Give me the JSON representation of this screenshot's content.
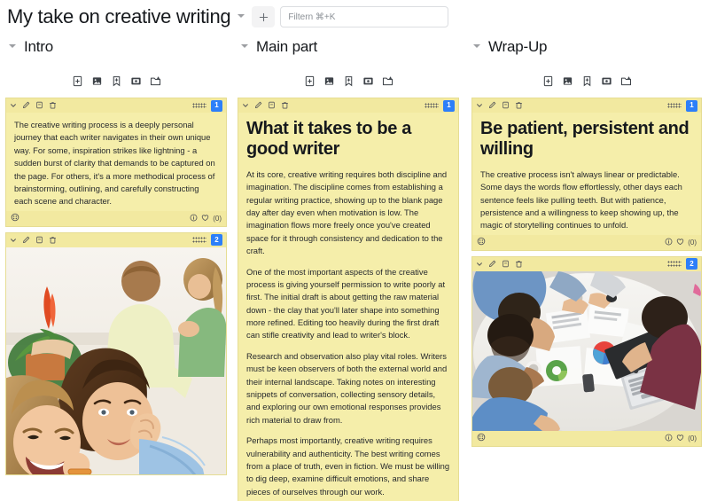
{
  "topbar": {
    "title": "My take on creative writing",
    "title_caret_icon": "chevron-down-icon",
    "add_button_icon": "plus-icon",
    "search_placeholder": "Filtern ⌘+K",
    "search_value": ""
  },
  "theme": {
    "card_bg": "#f5eeaa",
    "card_header_bg": "#f2e9a0",
    "card_border": "#e6dd93",
    "badge_blue": "#2d7ff9",
    "text": "#16191d",
    "page_bg": "#ffffff"
  },
  "column_tools": [
    {
      "name": "add-text-card-button",
      "icon": "note-plus-icon",
      "label": "Add text card"
    },
    {
      "name": "add-image-card-button",
      "icon": "image-plus-icon",
      "label": "Add image card"
    },
    {
      "name": "add-bookmark-card-button",
      "icon": "bookmark-plus-icon",
      "label": "Add bookmark card"
    },
    {
      "name": "add-media-card-button",
      "icon": "media-plus-icon",
      "label": "Add media card"
    },
    {
      "name": "add-folder-button",
      "icon": "folder-plus-icon",
      "label": "Add folder"
    }
  ],
  "card_header_tools": [
    {
      "name": "collapse-card-button",
      "icon": "chevron-down-icon"
    },
    {
      "name": "edit-card-button",
      "icon": "pencil-icon"
    },
    {
      "name": "duplicate-card-button",
      "icon": "copy-icon"
    },
    {
      "name": "delete-card-button",
      "icon": "trash-icon"
    }
  ],
  "card_footer_tools": [
    {
      "name": "palette-button",
      "icon": "palette-icon"
    },
    {
      "name": "info-button",
      "icon": "info-icon"
    },
    {
      "name": "like-button",
      "icon": "heart-icon"
    }
  ],
  "columns": [
    {
      "id": "intro",
      "title": "Intro",
      "caret_icon": "chevron-down-icon",
      "cards": [
        {
          "type": "text",
          "badge": "1",
          "heading": "",
          "paragraphs": [
            "The creative writing process is a deeply personal journey that each writer navigates in their own unique way. For some, inspiration strikes like lightning - a sudden burst of clarity that demands to be captured on the page. For others, it's a more methodical process of brainstorming, outlining, and carefully constructing each scene and character."
          ],
          "like_count": "(0)"
        },
        {
          "type": "image",
          "badge": "2",
          "image_alt": "Family relaxing on a couch, two children laughing in the foreground",
          "like_count": ""
        }
      ]
    },
    {
      "id": "main-part",
      "title": "Main part",
      "caret_icon": "chevron-down-icon",
      "cards": [
        {
          "type": "text",
          "badge": "1",
          "heading": "What it takes to be a good writer",
          "paragraphs": [
            "At its core, creative writing requires both discipline and imagination. The discipline comes from establishing a regular writing practice, showing up to the blank page day after day even when motivation is low. The imagination flows more freely once you've created space for it through consistency and dedication to the craft.",
            "One of the most important aspects of the creative process is giving yourself permission to write poorly at first. The initial draft is about getting the raw material down - the clay that you'll later shape into something more refined. Editing too heavily during the first draft can stifle creativity and lead to writer's block.",
            "Research and observation also play vital roles. Writers must be keen observers of both the external world and their internal landscape. Taking notes on interesting snippets of conversation, collecting sensory details, and exploring our own emotional responses provides rich material to draw from.",
            "Perhaps most importantly, creative writing requires vulnerability and authenticity. The best writing comes from a place of truth, even in fiction. We must be willing to dig deep, examine difficult emotions, and share pieces of ourselves through our work."
          ],
          "like_count": ""
        }
      ]
    },
    {
      "id": "wrap-up",
      "title": "Wrap-Up",
      "caret_icon": "chevron-down-icon",
      "cards": [
        {
          "type": "text",
          "badge": "1",
          "heading": "Be patient, persistent and willing",
          "paragraphs": [
            "The creative process isn't always linear or predictable. Some days the words flow effortlessly, other days each sentence feels like pulling teeth. But with patience, persistence and a willingness to keep showing up, the magic of storytelling continues to unfold."
          ],
          "like_count": "(0)"
        },
        {
          "type": "image",
          "badge": "2",
          "image_alt": "Overhead view of a team meeting around a table with charts, coffee cups and a laptop",
          "like_count": "(0)"
        }
      ]
    }
  ]
}
